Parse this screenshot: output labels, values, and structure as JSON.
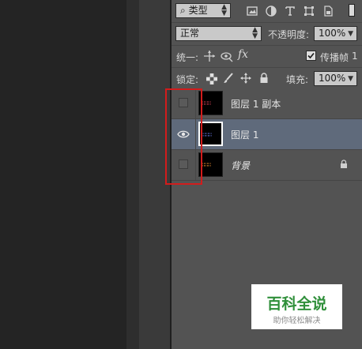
{
  "filter": {
    "kind_label": "类型",
    "search_glyph": "⌕"
  },
  "filter_icons": [
    "image-filter-icon",
    "adjustment-filter-icon",
    "type-filter-icon",
    "shape-filter-icon",
    "smart-object-filter-icon"
  ],
  "blend": {
    "mode": "正常",
    "opacity_label": "不透明度:",
    "opacity_value": "100%"
  },
  "unify": {
    "label": "统一:",
    "propagate_label": "传播帧",
    "propagate_value": "1",
    "propagate_checked": true
  },
  "lock": {
    "label": "锁定:",
    "fill_label": "填充:",
    "fill_value": "100%"
  },
  "layers": [
    {
      "name": "图层 1 副本",
      "visible": false,
      "selected": false,
      "locked": false,
      "italic": false,
      "thumb_color": "#e0455a"
    },
    {
      "name": "图层 1",
      "visible": true,
      "selected": true,
      "locked": false,
      "italic": false,
      "thumb_color": "#6b79e8"
    },
    {
      "name": "背景",
      "visible": false,
      "selected": false,
      "locked": true,
      "italic": true,
      "thumb_color": "#e48a2f"
    }
  ],
  "watermark": {
    "title": "百科全说",
    "subtitle": "助你轻松解决"
  },
  "colors": {
    "panel": "#535353",
    "selected_row": "#5f6a7b",
    "highlight": "#d21c1c",
    "brand": "#2f8f3a"
  }
}
